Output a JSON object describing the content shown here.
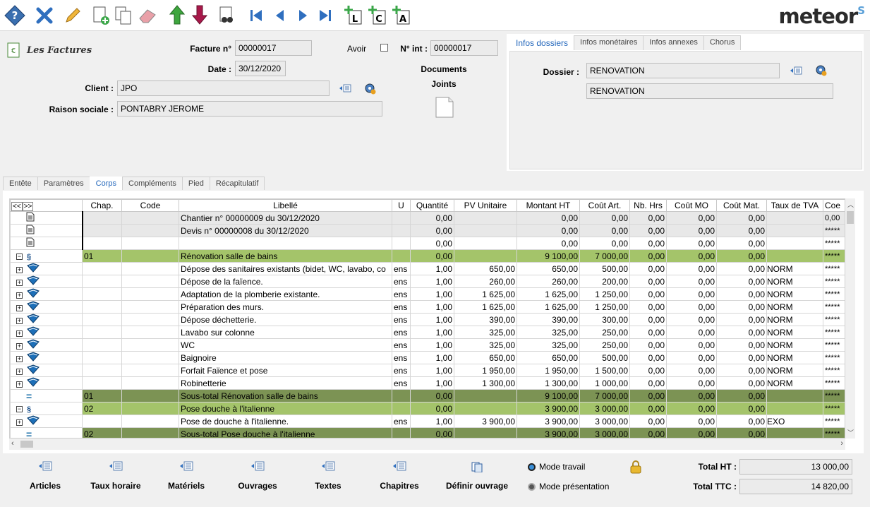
{
  "toolbar": {
    "brand": "meteor",
    "brand_mark": "S"
  },
  "header": {
    "module_title": "Les Factures",
    "invoice_label": "Facture n°",
    "invoice_value": "00000017",
    "avoir_label": "Avoir",
    "nint_label": "N° int :",
    "nint_value": "00000017",
    "date_label": "Date :",
    "date_value": "30/12/2020",
    "client_label": "Client :",
    "client_value": "JPO",
    "raison_label": "Raison sociale :",
    "raison_value": "PONTABRY JEROME",
    "docs_label1": "Documents",
    "docs_label2": "Joints"
  },
  "right_panel": {
    "tabs": [
      "Infos dossiers",
      "Infos monétaires",
      "Infos annexes",
      "Chorus"
    ],
    "dossier_label": "Dossier :",
    "dossier_value": "RENOVATION",
    "dossier_desc": "RENOVATION"
  },
  "main_tabs": [
    "Entête",
    "Paramètres",
    "Corps",
    "Compléments",
    "Pied",
    "Récapitulatif"
  ],
  "grid": {
    "nav": [
      "<<",
      ">>"
    ],
    "columns": [
      "Chap.",
      "Code",
      "Libellé",
      "U",
      "Quantité",
      "PV Unitaire",
      "Montant HT",
      "Coût Art.",
      "Nb. Hrs",
      "Coût MO",
      "Coût Mat.",
      "Taux de TVA",
      "Coe"
    ],
    "rows": [
      {
        "type": "note",
        "icon": "page-icon",
        "chap": "",
        "code": "",
        "lib": "Chantier n° 00000009 du 30/12/2020",
        "u": "",
        "qte": "0,00",
        "pv": "",
        "mht": "0,00",
        "ca": "0,00",
        "nbh": "0,00",
        "cmo": "0,00",
        "cmat": "0,00",
        "tva": "",
        "coe": "0,00"
      },
      {
        "type": "note",
        "icon": "page-icon",
        "chap": "",
        "code": "",
        "lib": "Devis n° 00000008 du 30/12/2020",
        "u": "",
        "qte": "0,00",
        "pv": "",
        "mht": "0,00",
        "ca": "0,00",
        "nbh": "0,00",
        "cmo": "0,00",
        "cmat": "0,00",
        "tva": "",
        "coe": "*****"
      },
      {
        "type": "note",
        "icon": "page-icon",
        "chap": "",
        "code": "",
        "lib": "",
        "u": "",
        "qte": "0,00",
        "pv": "",
        "mht": "0,00",
        "ca": "0,00",
        "nbh": "0,00",
        "cmo": "0,00",
        "cmat": "0,00",
        "tva": "",
        "coe": "*****"
      },
      {
        "type": "chap",
        "icon": "section-icon",
        "chap": "01",
        "code": "",
        "lib": "Rénovation salle de bains",
        "u": "",
        "qte": "0,00",
        "pv": "",
        "mht": "9 100,00",
        "ca": "7 000,00",
        "nbh": "0,00",
        "cmo": "0,00",
        "cmat": "0,00",
        "tva": "",
        "coe": "*****"
      },
      {
        "type": "item",
        "icon": "book-icon",
        "chap": "",
        "code": "",
        "lib": "Dépose des sanitaires existants (bidet, WC, lavabo, co",
        "u": "ens",
        "qte": "1,00",
        "pv": "650,00",
        "mht": "650,00",
        "ca": "500,00",
        "nbh": "0,00",
        "cmo": "0,00",
        "cmat": "0,00",
        "tva": "NORM",
        "coe": "*****"
      },
      {
        "type": "item",
        "icon": "book-icon",
        "chap": "",
        "code": "",
        "lib": "Dépose de la faïence.",
        "u": "ens",
        "qte": "1,00",
        "pv": "260,00",
        "mht": "260,00",
        "ca": "200,00",
        "nbh": "0,00",
        "cmo": "0,00",
        "cmat": "0,00",
        "tva": "NORM",
        "coe": "*****"
      },
      {
        "type": "item",
        "icon": "book-icon",
        "chap": "",
        "code": "",
        "lib": "Adaptation de la plomberie existante.",
        "u": "ens",
        "qte": "1,00",
        "pv": "1 625,00",
        "mht": "1 625,00",
        "ca": "1 250,00",
        "nbh": "0,00",
        "cmo": "0,00",
        "cmat": "0,00",
        "tva": "NORM",
        "coe": "*****"
      },
      {
        "type": "item",
        "icon": "book-icon",
        "chap": "",
        "code": "",
        "lib": "Préparation des murs.",
        "u": "ens",
        "qte": "1,00",
        "pv": "1 625,00",
        "mht": "1 625,00",
        "ca": "1 250,00",
        "nbh": "0,00",
        "cmo": "0,00",
        "cmat": "0,00",
        "tva": "NORM",
        "coe": "*****"
      },
      {
        "type": "item",
        "icon": "book-icon",
        "chap": "",
        "code": "",
        "lib": "Dépose déchetterie.",
        "u": "ens",
        "qte": "1,00",
        "pv": "390,00",
        "mht": "390,00",
        "ca": "300,00",
        "nbh": "0,00",
        "cmo": "0,00",
        "cmat": "0,00",
        "tva": "NORM",
        "coe": "*****"
      },
      {
        "type": "item",
        "icon": "book-icon",
        "chap": "",
        "code": "",
        "lib": "Lavabo sur colonne",
        "u": "ens",
        "qte": "1,00",
        "pv": "325,00",
        "mht": "325,00",
        "ca": "250,00",
        "nbh": "0,00",
        "cmo": "0,00",
        "cmat": "0,00",
        "tva": "NORM",
        "coe": "*****"
      },
      {
        "type": "item",
        "icon": "book-icon",
        "chap": "",
        "code": "",
        "lib": "WC",
        "u": "ens",
        "qte": "1,00",
        "pv": "325,00",
        "mht": "325,00",
        "ca": "250,00",
        "nbh": "0,00",
        "cmo": "0,00",
        "cmat": "0,00",
        "tva": "NORM",
        "coe": "*****"
      },
      {
        "type": "item",
        "icon": "book-icon",
        "chap": "",
        "code": "",
        "lib": "Baignoire",
        "u": "ens",
        "qte": "1,00",
        "pv": "650,00",
        "mht": "650,00",
        "ca": "500,00",
        "nbh": "0,00",
        "cmo": "0,00",
        "cmat": "0,00",
        "tva": "NORM",
        "coe": "*****"
      },
      {
        "type": "item",
        "icon": "book-icon",
        "chap": "",
        "code": "",
        "lib": "Forfait Faïence et pose",
        "u": "ens",
        "qte": "1,00",
        "pv": "1 950,00",
        "mht": "1 950,00",
        "ca": "1 500,00",
        "nbh": "0,00",
        "cmo": "0,00",
        "cmat": "0,00",
        "tva": "NORM",
        "coe": "*****"
      },
      {
        "type": "item",
        "icon": "book-icon",
        "chap": "",
        "code": "",
        "lib": "Robinetterie",
        "u": "ens",
        "qte": "1,00",
        "pv": "1 300,00",
        "mht": "1 300,00",
        "ca": "1 000,00",
        "nbh": "0,00",
        "cmo": "0,00",
        "cmat": "0,00",
        "tva": "NORM",
        "coe": "*****"
      },
      {
        "type": "sub",
        "icon": "subtotal-icon",
        "chap": "01",
        "code": "",
        "lib": "Sous-total Rénovation salle de bains",
        "u": "",
        "qte": "0,00",
        "pv": "",
        "mht": "9 100,00",
        "ca": "7 000,00",
        "nbh": "0,00",
        "cmo": "0,00",
        "cmat": "0,00",
        "tva": "",
        "coe": "*****"
      },
      {
        "type": "chap",
        "icon": "section-icon",
        "chap": "02",
        "code": "",
        "lib": "Pose douche à l'italienne",
        "u": "",
        "qte": "0,00",
        "pv": "",
        "mht": "3 900,00",
        "ca": "3 000,00",
        "nbh": "0,00",
        "cmo": "0,00",
        "cmat": "0,00",
        "tva": "",
        "coe": "*****"
      },
      {
        "type": "item",
        "icon": "book-icon",
        "chap": "",
        "code": "",
        "lib": "Pose de douche à l'italienne.",
        "u": "ens",
        "qte": "1,00",
        "pv": "3 900,00",
        "mht": "3 900,00",
        "ca": "3 000,00",
        "nbh": "0,00",
        "cmo": "0,00",
        "cmat": "0,00",
        "tva": "EXO",
        "coe": "*****"
      },
      {
        "type": "sub",
        "icon": "subtotal-icon",
        "chap": "02",
        "code": "",
        "lib": "Sous-total Pose douche à l'italienne",
        "u": "",
        "qte": "0,00",
        "pv": "",
        "mht": "3 900,00",
        "ca": "3 000,00",
        "nbh": "0,00",
        "cmo": "0,00",
        "cmat": "0,00",
        "tva": "",
        "coe": "*****"
      }
    ]
  },
  "bottom": {
    "buttons": [
      "Articles",
      "Taux horaire",
      "Matériels",
      "Ouvrages",
      "Textes",
      "Chapitres",
      "Définir ouvrage"
    ],
    "mode_travail": "Mode travail",
    "mode_presentation": "Mode présentation",
    "total_ht_label": "Total HT :",
    "total_ht_value": "13 000,00",
    "total_ttc_label": "Total TTC :",
    "total_ttc_value": "14 820,00"
  },
  "colors": {
    "chapter_row": "#a4c46a",
    "subtotal_row": "#7c9354",
    "active_tab": "#2266bb",
    "brand": "#2b2b2b"
  }
}
